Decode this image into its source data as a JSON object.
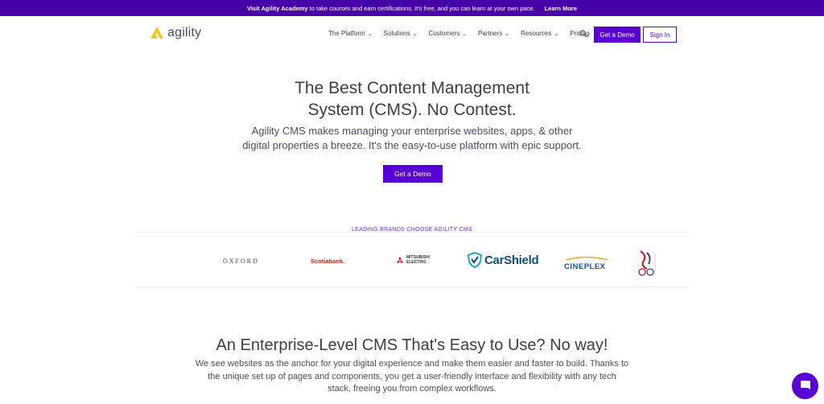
{
  "announcement": {
    "lead": "Visit Agility Academy",
    "text": "to take courses and earn certifications. It's free, and you can learn at your own pace.",
    "link": "Learn More"
  },
  "header": {
    "logo_text": "agility",
    "menu": [
      {
        "label": "The Platform"
      },
      {
        "label": "Solutions"
      },
      {
        "label": "Customers"
      },
      {
        "label": "Partners"
      },
      {
        "label": "Resources"
      },
      {
        "label": "Pricing"
      }
    ],
    "search_icon": "search-icon",
    "demo_button": "Get a Demo",
    "signin_button": "Sign In"
  },
  "hero": {
    "title_line1": "The Best Content Management",
    "title_line2": "System (CMS). No Contest.",
    "subtitle_line1": "Agility CMS makes managing your enterprise websites, apps, & other",
    "subtitle_line2": "digital properties a breeze. It's the easy-to-use platform with epic support.",
    "cta": "Get a Demo"
  },
  "brands": {
    "label": "LEADING BRANDS CHOOSE AGILITY CMS",
    "logos": {
      "oxford": "OXFORD",
      "scotiabank": "Scotiabank.",
      "mitsubishi_line1": "MITSUBISHI",
      "mitsubishi_line2": "ELECTRIC",
      "carshield": "CarShield",
      "cineplex": "CINEPLEX"
    }
  },
  "section": {
    "title": "An Enterprise-Level CMS That's Easy to Use? No way!",
    "text_line1": "We see websites as the anchor for your digital experience and make them easier and faster to build. Thanks to",
    "text_line2": "the unique set up of pages and components, you get a user-friendly interface and flexibility with any tech",
    "text_line3": "stack, freeing you from complex workflows."
  },
  "colors": {
    "brand_purple": "#5800d4",
    "topbar": "#4600a8",
    "logo_yellow": "#f5c518"
  }
}
